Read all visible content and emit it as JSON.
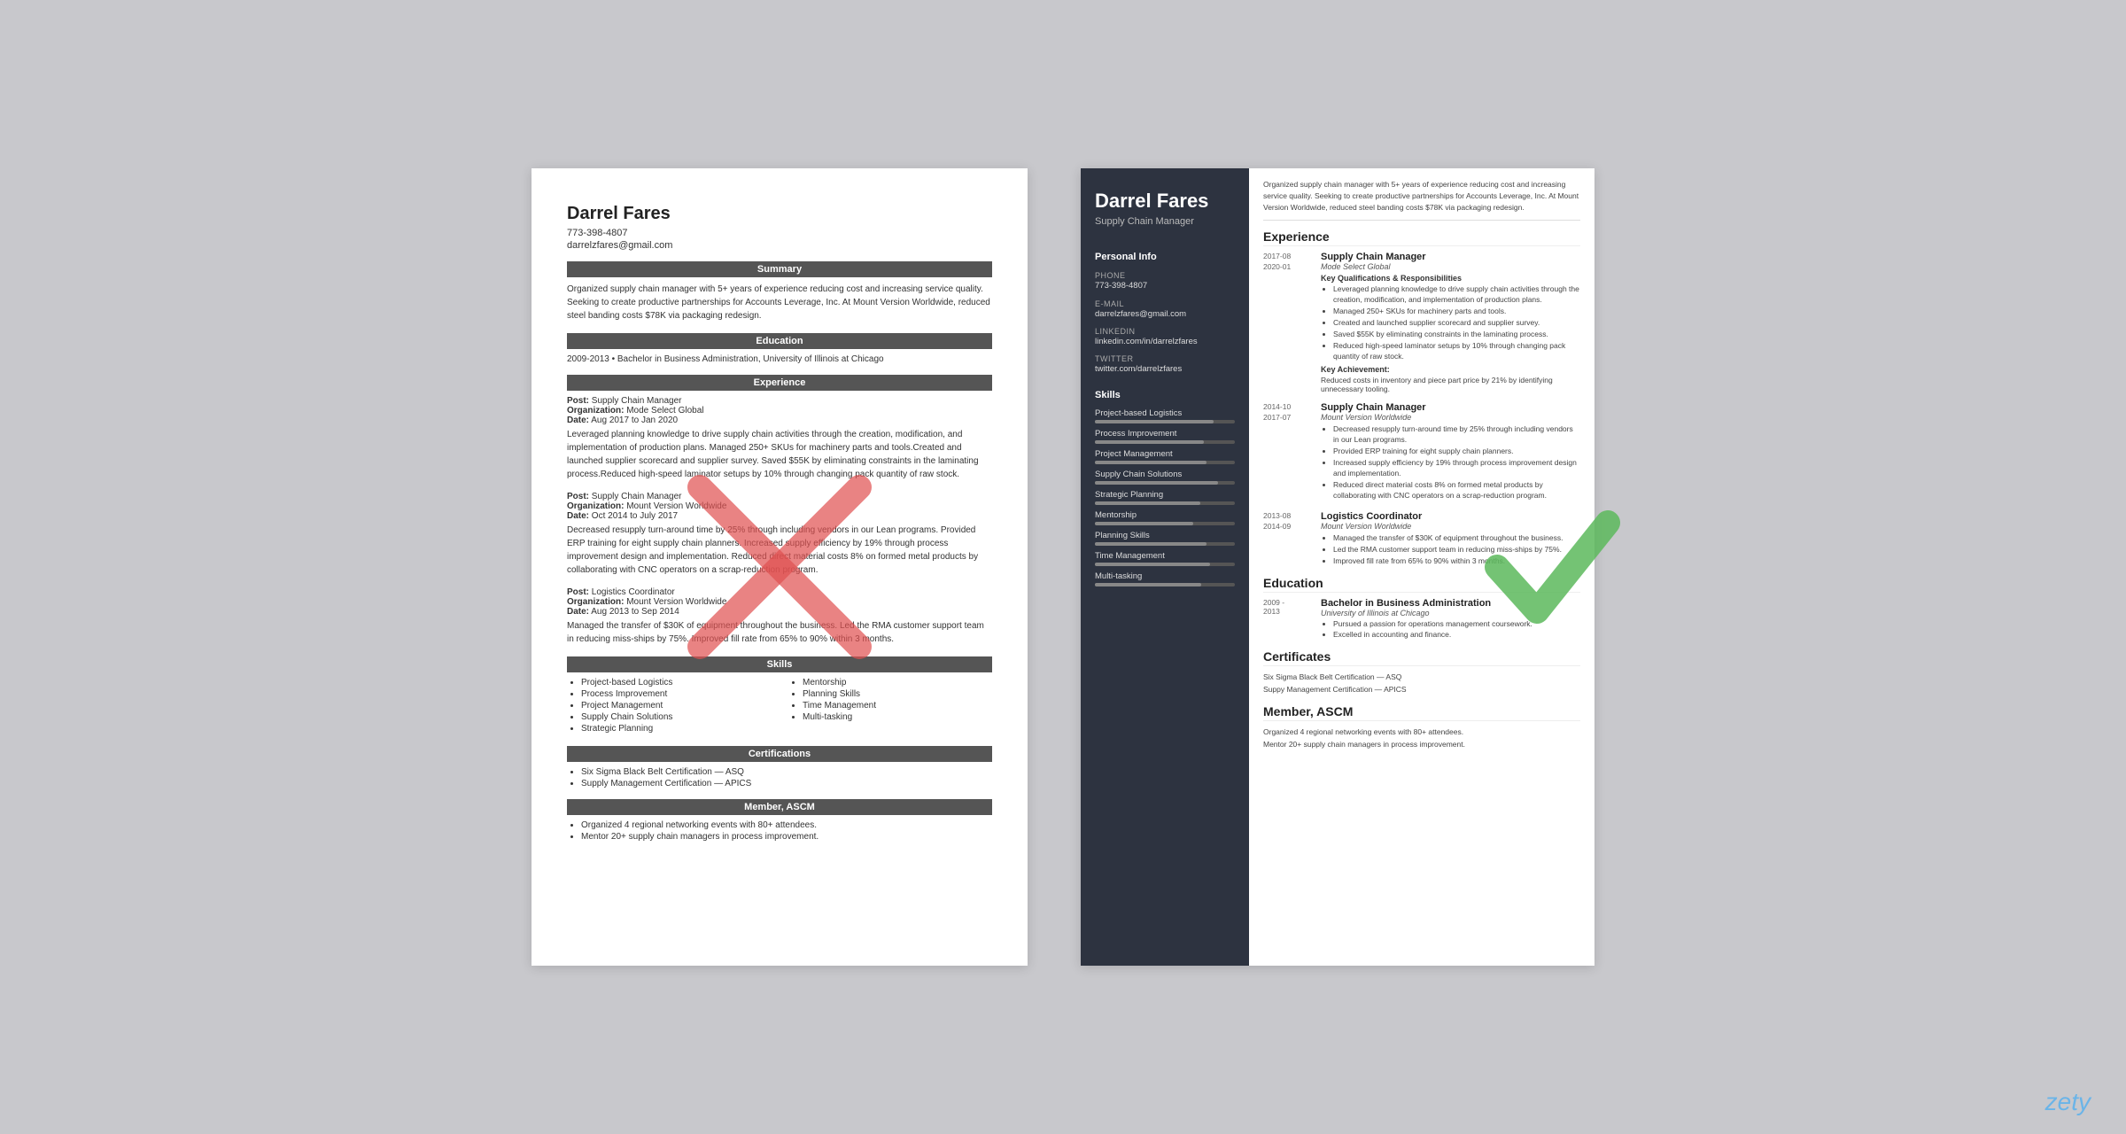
{
  "left_resume": {
    "name": "Darrel Fares",
    "phone": "773-398-4807",
    "email": "darrelzfares@gmail.com",
    "sections": {
      "summary": {
        "header": "Summary",
        "text": "Organized supply chain manager with 5+ years of experience reducing cost and increasing service quality. Seeking to create productive partnerships for Accounts Leverage, Inc. At Mount Version Worldwide, reduced steel banding costs $78K via packaging redesign."
      },
      "education": {
        "header": "Education",
        "entry": "2009-2013 • Bachelor in Business Administration, University of Illinois at Chicago"
      },
      "experience": {
        "header": "Experience",
        "jobs": [
          {
            "post": "Post: Supply Chain Manager",
            "org": "Organization: Mode Select Global",
            "date": "Date: Aug 2017 to Jan 2020",
            "desc": "Leveraged planning knowledge to drive supply chain activities through the creation, modification, and implementation of production plans. Managed 250+ SKUs for machinery parts and tools.Created and launched supplier scorecard and supplier survey. Saved $55K by eliminating constraints in the laminating process.Reduced high-speed laminator setups by 10% through changing pack quantity of raw stock."
          },
          {
            "post": "Post: Supply Chain Manager",
            "org": "Organization: Mount Version Worldwide",
            "date": "Date: Oct 2014 to July 2017",
            "desc": "Decreased resupply turn-around time by 25% through including vendors in our Lean programs. Provided ERP training for eight supply chain planners. Increased supply efficiency by 19% through process improvement design and implementation. Reduced direct material costs 8% on formed metal products by collaborating with CNC operators on a scrap-reduction program."
          },
          {
            "post": "Post: Logistics Coordinator",
            "org": "Organization: Mount Version Worldwide",
            "date": "Date: Aug 2013 to Sep 2014",
            "desc": "Managed the transfer of $30K of equipment throughout the business. Led the RMA customer support team in reducing miss-ships by 75%. Improved fill rate from 65% to 90% within 3 months."
          }
        ]
      },
      "skills": {
        "header": "Skills",
        "col1": [
          "Project-based Logistics",
          "Process Improvement",
          "Project Management",
          "Supply Chain Solutions",
          "Strategic Planning"
        ],
        "col2": [
          "Mentorship",
          "Planning Skills",
          "Time Management",
          "Multi-tasking"
        ]
      },
      "certifications": {
        "header": "Certifications",
        "items": [
          "Six Sigma Black Belt Certification — ASQ",
          "Supply Management Certification — APICS"
        ]
      },
      "member": {
        "header": "Member, ASCM",
        "items": [
          "Organized 4 regional networking events with 80+ attendees.",
          "Mentor 20+ supply chain managers in process improvement."
        ]
      }
    }
  },
  "right_resume": {
    "name": "Darrel Fares",
    "title": "Supply Chain Manager",
    "intro": "Organized supply chain manager with 5+ years of experience reducing cost and increasing service quality. Seeking to create productive partnerships for Accounts Leverage, Inc. At Mount Version Worldwide, reduced steel banding costs $78K via packaging redesign.",
    "sidebar": {
      "personal_info_heading": "Personal Info",
      "phone_label": "Phone",
      "phone": "773-398-4807",
      "email_label": "E-mail",
      "email": "darrelzfares@gmail.com",
      "linkedin_label": "LinkedIn",
      "linkedin": "linkedin.com/in/darrelzfares",
      "twitter_label": "Twitter",
      "twitter": "twitter.com/darrelzfares",
      "skills_heading": "Skills",
      "skills": [
        {
          "name": "Project-based Logistics",
          "pct": 85
        },
        {
          "name": "Process Improvement",
          "pct": 78
        },
        {
          "name": "Project Management",
          "pct": 80
        },
        {
          "name": "Supply Chain Solutions",
          "pct": 88
        },
        {
          "name": "Strategic Planning",
          "pct": 75
        },
        {
          "name": "Mentorship",
          "pct": 70
        },
        {
          "name": "Planning Skills",
          "pct": 80
        },
        {
          "name": "Time Management",
          "pct": 82
        },
        {
          "name": "Multi-tasking",
          "pct": 76
        }
      ]
    },
    "experience_heading": "Experience",
    "jobs": [
      {
        "date_start": "2017-08",
        "date_end": "2020-01",
        "title": "Supply Chain Manager",
        "org": "Mode Select Global",
        "kq_label": "Key Qualifications & Responsibilities",
        "bullets": [
          "Leveraged planning knowledge to drive supply chain activities through the creation, modification, and implementation of production plans.",
          "Managed 250+ SKUs for machinery parts and tools.",
          "Created and launched supplier scorecard and supplier survey.",
          "Saved $55K by eliminating constraints in the laminating process.",
          "Reduced high-speed laminator setups by 10% through changing pack quantity of raw stock."
        ],
        "ka_label": "Key Achievement:",
        "achievement": "Reduced costs in inventory and piece part price by 21% by identifying unnecessary tooling."
      },
      {
        "date_start": "2014-10",
        "date_end": "2017-07",
        "title": "Supply Chain Manager",
        "org": "Mount Version Worldwide",
        "bullets": [
          "Decreased resupply turn-around time by 25% through including vendors in our Lean programs.",
          "Provided ERP training for eight supply chain planners.",
          "Increased supply efficiency by 19% through process improvement design and implementation.",
          "Reduced direct material costs 8% on formed metal products by collaborating with CNC operators on a scrap-reduction program."
        ]
      },
      {
        "date_start": "2013-08",
        "date_end": "2014-09",
        "title": "Logistics Coordinator",
        "org": "Mount Version Worldwide",
        "bullets": [
          "Managed the transfer of $30K of equipment throughout the business.",
          "Led the RMA customer support team in reducing miss-ships by 75%.",
          "Improved fill rate from 65% to 90% within 3 months."
        ]
      }
    ],
    "education_heading": "Education",
    "education": [
      {
        "date_start": "2009",
        "date_end": "2013",
        "degree": "Bachelor in Business Administration",
        "school": "University of Illinois at Chicago",
        "bullets": [
          "Pursued a passion for operations management coursework.",
          "Excelled in accounting and finance."
        ]
      }
    ],
    "certificates_heading": "Certificates",
    "certificates": [
      "Six Sigma Black Belt Certification — ASQ",
      "Suppy Management Certification — APICS"
    ],
    "member_heading": "Member, ASCM",
    "member_items": [
      "Organized 4 regional networking events with 80+ attendees.",
      "Mentor 20+ supply chain managers in process improvement."
    ]
  },
  "zety_label": "zety"
}
